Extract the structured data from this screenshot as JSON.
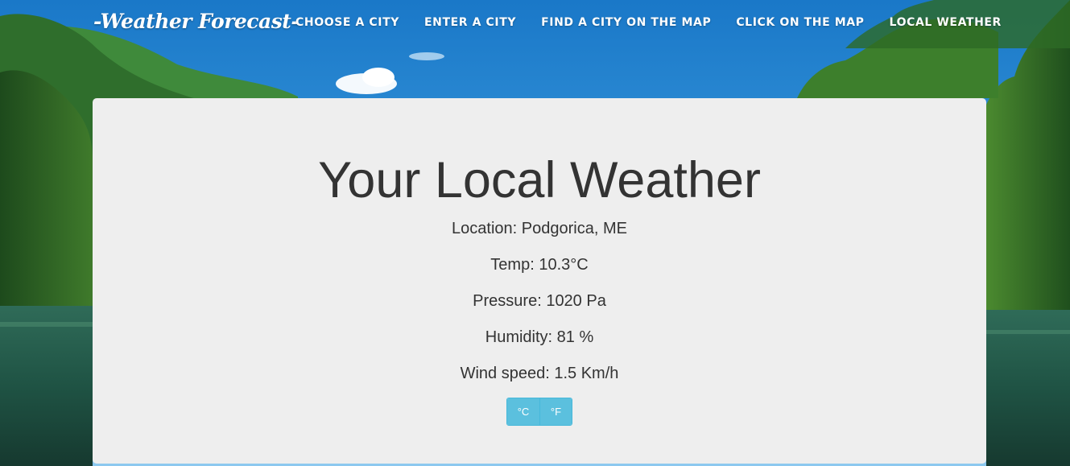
{
  "nav": {
    "brand": "-Weather Forecast-",
    "links": [
      "CHOOSE A CITY",
      "ENTER A CITY",
      "FIND A CITY ON THE MAP",
      "CLICK ON THE MAP",
      "LOCAL WEATHER"
    ]
  },
  "weather": {
    "title": "Your Local Weather",
    "location": "Location: Podgorica, ME",
    "temp": "Temp: 10.3°C",
    "pressure": "Pressure: 1020 Pa",
    "humidity": "Humidity: 81 %",
    "wind": "Wind speed: 1.5 Km/h"
  },
  "units": {
    "celsius_label": "°C",
    "fahrenheit_label": "°F"
  },
  "colors": {
    "panel_bg": "#eeeeee",
    "text": "#333333",
    "toggle_bg": "#5bc0de",
    "toggle_border": "#46b8da"
  },
  "background": {
    "scene": "forest-lake-landscape"
  }
}
